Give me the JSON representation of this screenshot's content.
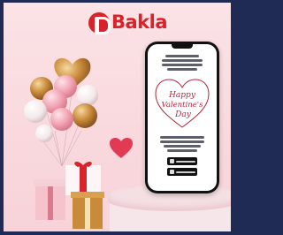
{
  "brand": {
    "logo_text": "Bakla",
    "brand_color": "#d8232a"
  },
  "phone": {
    "card_title_line1": "Happy",
    "card_title_line2": "Valentine's",
    "card_title_line3": "Day",
    "store_buttons": [
      "app-store-icon",
      "google-play-icon"
    ]
  },
  "colors": {
    "background": "#fbe3e6",
    "frame_border": "#1f2a55",
    "balloon_gold": "#c98a3a",
    "balloon_pink": "#f2a3b3",
    "balloon_white": "#fbf3f4",
    "heart_red": "#e23a55"
  }
}
